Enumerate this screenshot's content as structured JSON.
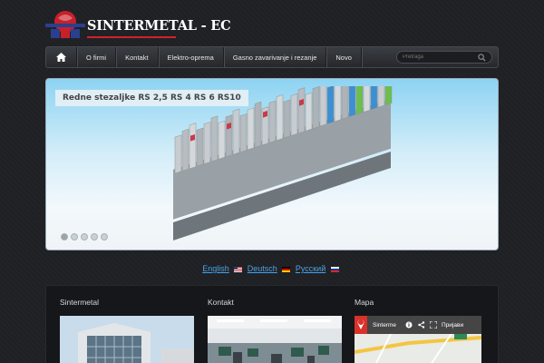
{
  "brand": {
    "name": "SINTERMETAL - EC",
    "accent": "#d0222a"
  },
  "nav": {
    "home_icon": "home-icon",
    "items": [
      "O firmi",
      "Kontakt",
      "Elektro-oprema",
      "Gasno zavarivanje i rezanje",
      "Novo"
    ],
    "search_placeholder": "Pretraga"
  },
  "slider": {
    "title": "Redne stezaljke RS 2,5 RS 4 RS 6 RS10",
    "dot_count": 5,
    "active_dot": 1
  },
  "languages": [
    {
      "label": "English",
      "flag": "us-flag"
    },
    {
      "label": "Deutsch",
      "flag": "de-flag"
    },
    {
      "label": "Русский",
      "flag": "ru-flag"
    }
  ],
  "footer": {
    "columns": [
      {
        "title": "Sintermetal"
      },
      {
        "title": "Kontakt"
      },
      {
        "title": "Mapa"
      }
    ],
    "map": {
      "place": "Sinterme",
      "directions": "Пријави"
    }
  }
}
